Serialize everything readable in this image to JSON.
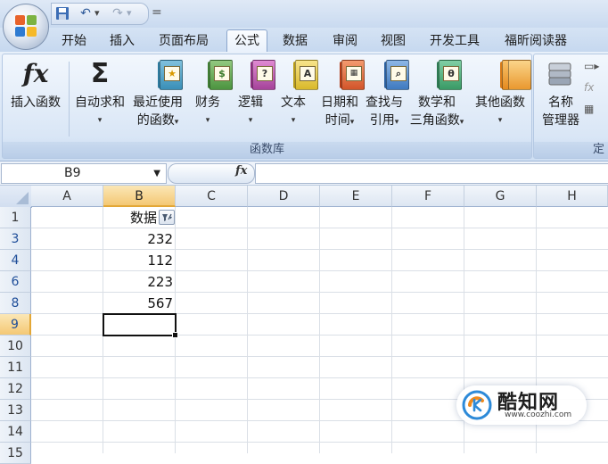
{
  "quick_access": {
    "menu_marker": "="
  },
  "tabs": [
    "开始",
    "插入",
    "页面布局",
    "公式",
    "数据",
    "审阅",
    "视图",
    "开发工具",
    "福昕阅读器"
  ],
  "active_tab": "公式",
  "ribbon": {
    "insert_function": {
      "label": "插入函数",
      "glyph": "fx"
    },
    "autosum": {
      "label": "自动求和",
      "glyph": "Σ"
    },
    "recent": {
      "line1": "最近使用",
      "line2": "的函数"
    },
    "financial": {
      "label": "财务"
    },
    "logical": {
      "label": "逻辑",
      "glyph": "?"
    },
    "text": {
      "label": "文本",
      "glyph": "A"
    },
    "datetime": {
      "line1": "日期和",
      "line2": "时间"
    },
    "lookup": {
      "line1": "查找与",
      "line2": "引用"
    },
    "math": {
      "line1": "数学和",
      "line2": "三角函数",
      "glyph": "θ"
    },
    "more": {
      "label": "其他函数"
    },
    "group_label": "函数库",
    "name_manager": {
      "line1": "名称",
      "line2": "管理器"
    },
    "group2_label_partial": "定"
  },
  "formula_bar": {
    "name_box": "B9",
    "fx": "fx",
    "formula": ""
  },
  "columns": [
    "A",
    "B",
    "C",
    "D",
    "E",
    "F",
    "G",
    "H"
  ],
  "rows": [
    "1",
    "3",
    "4",
    "6",
    "8",
    "9",
    "10",
    "11",
    "12",
    "13",
    "14",
    "15"
  ],
  "selected_cell": "B9",
  "cells": {
    "header": "数据",
    "values": [
      "232",
      "112",
      "223",
      "567"
    ]
  },
  "watermark": {
    "name": "酷知网",
    "url": "www.coozhi.com"
  },
  "colors": {
    "accent": "#f4c874",
    "ribbon": "#cfdff3",
    "selected_border": "#111111"
  }
}
